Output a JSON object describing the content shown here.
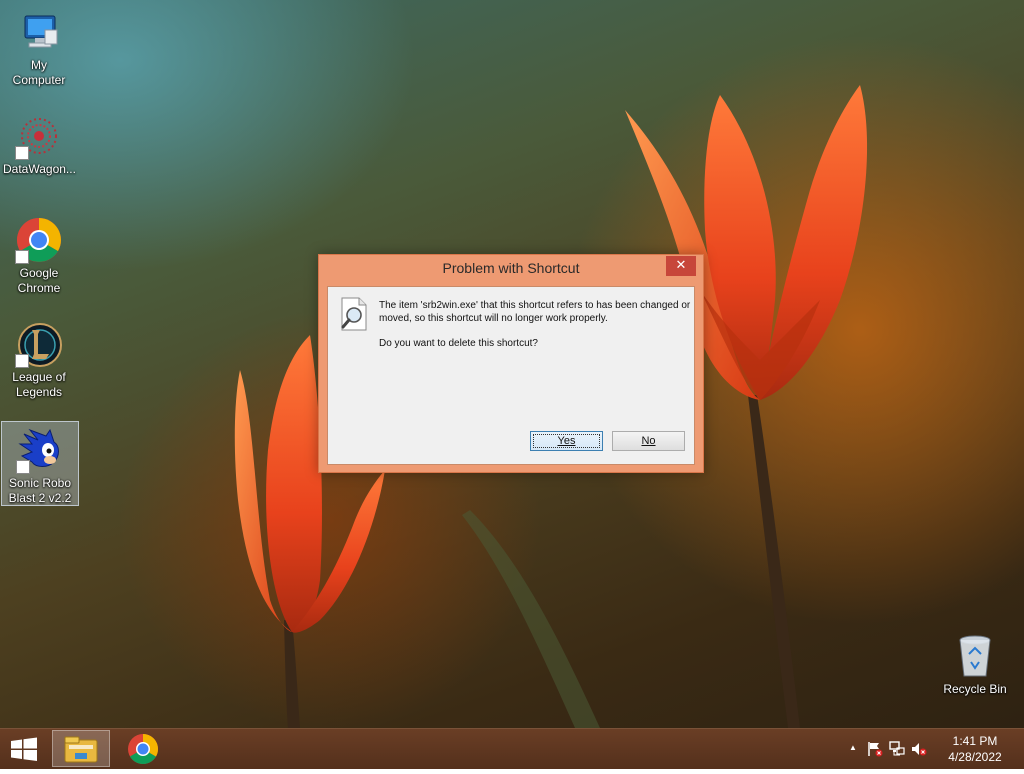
{
  "desktop": {
    "icons": [
      {
        "label": "My Computer"
      },
      {
        "label": "DataWagon..."
      },
      {
        "label": "Google Chrome"
      },
      {
        "label": "League of Legends"
      },
      {
        "label": "Sonic Robo Blast 2 v2.2"
      },
      {
        "label": "Recycle Bin"
      }
    ]
  },
  "dialog": {
    "title": "Problem with Shortcut",
    "close_glyph": "✕",
    "message": "The item 'srb2win.exe' that this shortcut refers to has been changed or moved, so this shortcut will no longer work properly.",
    "question": "Do you want to delete this shortcut?",
    "yes_label": "Yes",
    "no_label": "No"
  },
  "taskbar": {
    "clock_time": "1:41 PM",
    "clock_date": "4/28/2022",
    "tray_expand_glyph": "▲"
  },
  "colors": {
    "dialog_frame": "#ee9a72",
    "close_button": "#c7463a",
    "taskbar": "#5e3620"
  }
}
